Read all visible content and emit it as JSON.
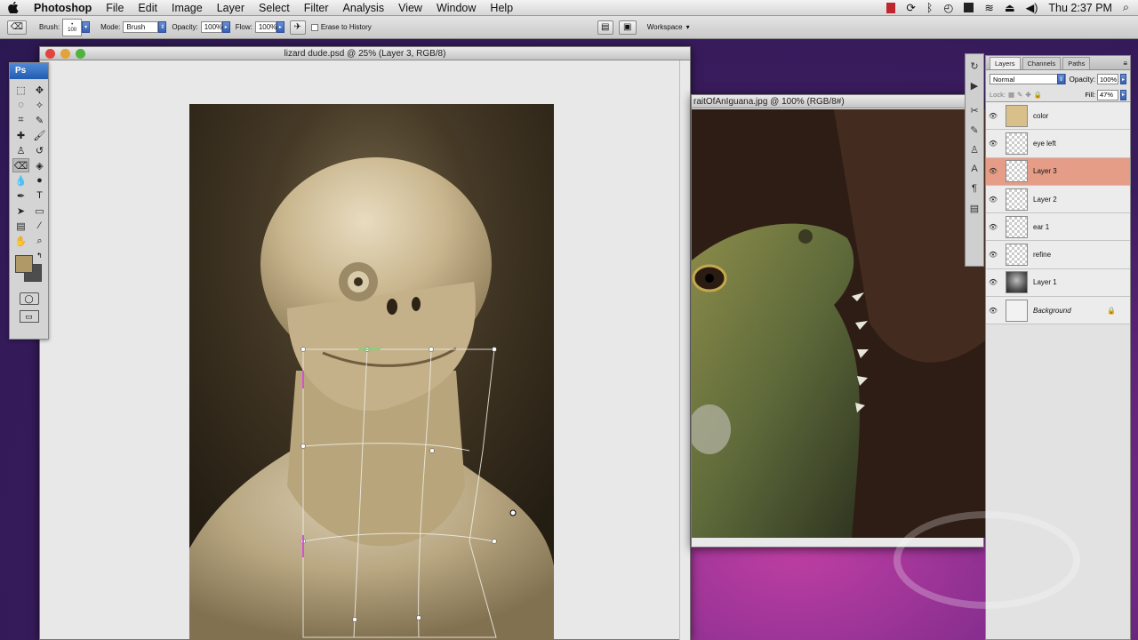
{
  "menubar": {
    "app": "Photoshop",
    "items": [
      "File",
      "Edit",
      "Image",
      "Layer",
      "Select",
      "Filter",
      "Analysis",
      "View",
      "Window",
      "Help"
    ],
    "clock": "Thu 2:37 PM"
  },
  "options": {
    "brush_label": "Brush:",
    "brush_size": "100",
    "mode_label": "Mode:",
    "mode_value": "Brush",
    "opacity_label": "Opacity:",
    "opacity_value": "100%",
    "flow_label": "Flow:",
    "flow_value": "100%",
    "erase_history": "Erase to History",
    "workspace": "Workspace"
  },
  "tools": {
    "logo": "Ps"
  },
  "doc": {
    "title": "lizard dude.psd @ 25% (Layer 3, RGB/8)"
  },
  "iguana": {
    "title": "raitOfAnIguana.jpg @ 100% (RGB/8#)"
  },
  "layers_panel": {
    "tabs": [
      "Layers",
      "Channels",
      "Paths"
    ],
    "blend_mode": "Normal",
    "opacity_label": "Opacity:",
    "opacity_value": "100%",
    "lock_label": "Lock:",
    "fill_label": "Fill:",
    "fill_value": "47%",
    "layers": [
      {
        "name": "color",
        "thumb": "#d9c08a"
      },
      {
        "name": "eye left",
        "thumb": "transparent"
      },
      {
        "name": "Layer 3",
        "thumb": "transparent",
        "active": true
      },
      {
        "name": "Layer 2",
        "thumb": "transparent"
      },
      {
        "name": "ear 1",
        "thumb": "transparent"
      },
      {
        "name": "refine",
        "thumb": "transparent"
      },
      {
        "name": "Layer 1",
        "thumb": "photo"
      },
      {
        "name": "Background",
        "thumb": "#f2f2f2",
        "locked": true
      }
    ]
  }
}
